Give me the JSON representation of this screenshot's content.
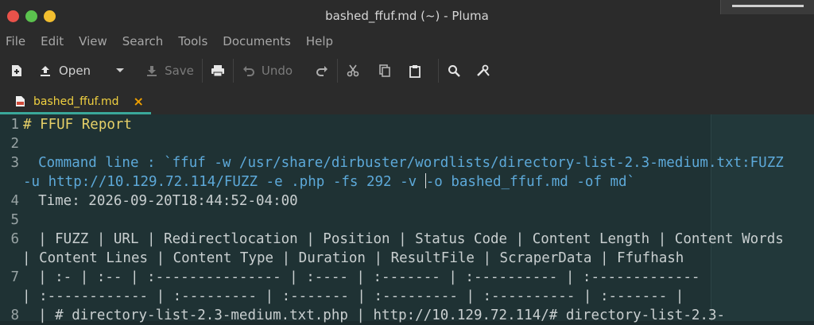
{
  "window": {
    "title": "bashed_ffuf.md (~) - Pluma"
  },
  "menu": [
    "File",
    "Edit",
    "View",
    "Search",
    "Tools",
    "Documents",
    "Help"
  ],
  "toolbar": {
    "open_label": "Open",
    "save_label": "Save",
    "undo_label": "Undo"
  },
  "tab": {
    "label": "bashed_ffuf.md",
    "close": "×"
  },
  "editor": {
    "line_numbers": [
      "1",
      "2",
      "3",
      "4",
      "5",
      "6",
      "7",
      "8"
    ],
    "lines": {
      "l1": "# FFUF Report",
      "l3a": "  Command line : `ffuf -w /usr/share/dirbuster/wordlists/directory-list-2.3-medium.txt:FUZZ",
      "l3b_pre": "-u http://10.129.72.114/FUZZ -e .php -fs 292 -v ",
      "l3b_post": "-o bashed_ffuf.md -of md`",
      "l4": "  Time: 2026-09-20T18:44:52-04:00",
      "l6a": "  | FUZZ | URL | Redirectlocation | Position | Status Code | Content Length | Content Words",
      "l6b": "| Content Lines | Content Type | Duration | ResultFile | ScraperData | Ffufhash",
      "l7a": "  | :- | :-- | :--------------- | :---- | :------- | :---------- | :-------------",
      "l7b": "| :------------ | :--------- | :------- | :--------- | :---------- | :------- |",
      "l8": "  | # directory-list-2.3-medium.txt.php | http://10.129.72.114/# directory-list-2.3-"
    }
  }
}
